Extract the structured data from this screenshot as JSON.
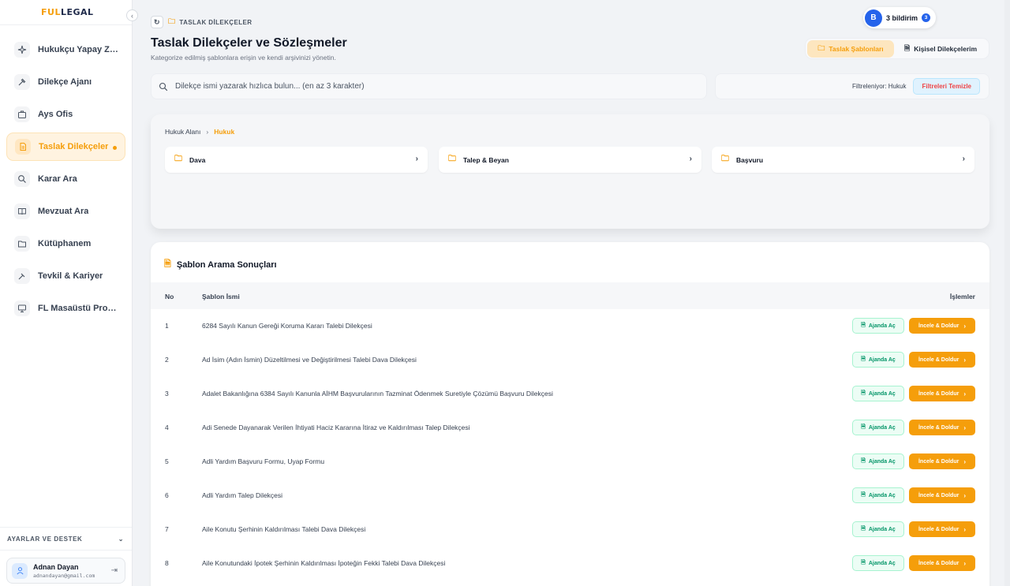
{
  "logo": {
    "part1": "FUL",
    "part2": "LEGAL"
  },
  "sidebar": {
    "items": [
      {
        "label": "Hukukçu Yapay Zeka",
        "icon": "sparkles-icon"
      },
      {
        "label": "Dilekçe Ajanı",
        "icon": "gavel-icon"
      },
      {
        "label": "Ays Ofis",
        "icon": "briefcase-icon"
      },
      {
        "label": "Taslak Dilekçeler",
        "icon": "document-icon",
        "active": true
      },
      {
        "label": "Karar Ara",
        "icon": "search-icon"
      },
      {
        "label": "Mevzuat Ara",
        "icon": "book-icon"
      },
      {
        "label": "Kütüphanem",
        "icon": "folder-icon"
      },
      {
        "label": "Tevkil & Kariyer",
        "icon": "hammer-icon"
      },
      {
        "label": "FL Masaüstü Programı",
        "icon": "desktop-icon"
      }
    ],
    "settings_label": "AYARLAR VE DESTEK",
    "user": {
      "name": "Adnan Dayan",
      "email": "adnandayan@gmail.com"
    }
  },
  "header": {
    "breadcrumb": "TASLAK DİLEKÇELER",
    "title": "Taslak Dilekçeler ve Sözleşmeler",
    "subtitle": "Kategorize edilmiş şablonlara erişin ve kendi arşivinizi yönetin.",
    "notifications": {
      "avatar": "B",
      "label": "3 bildirim",
      "count": "3"
    },
    "tabs": [
      {
        "label": "Taslak Şablonları",
        "active": true
      },
      {
        "label": "Kişisel Dilekçelerim",
        "active": false
      }
    ]
  },
  "search": {
    "placeholder": "Dilekçe ismi yazarak hızlıca bulun... (en az 3 karakter)",
    "value": ""
  },
  "filter": {
    "text": "Filtreleniyor: Hukuk",
    "clear_label": "Filtreleri Temizle"
  },
  "categories": {
    "breadcrumb_root": "Hukuk Alanı",
    "breadcrumb_current": "Hukuk",
    "items": [
      "Dava",
      "Talep & Beyan",
      "Başvuru"
    ]
  },
  "results": {
    "title": "Şablon Arama Sonuçları",
    "columns": {
      "no": "No",
      "name": "Şablon İsmi",
      "actions": "İşlemler"
    },
    "action_a": "Ajanda Aç",
    "action_b": "İncele & Doldur",
    "rows": [
      {
        "no": "1",
        "name": "6284 Sayılı Kanun Gereği Koruma Kararı Talebi Dilekçesi"
      },
      {
        "no": "2",
        "name": "Ad İsim (Adın İsmin) Düzeltilmesi ve Değiştirilmesi Talebi Dava Dilekçesi"
      },
      {
        "no": "3",
        "name": "Adalet Bakanlığına 6384 Sayılı Kanunla AİHM Başvurularının Tazminat Ödenmek Suretiyle Çözümü Başvuru Dilekçesi"
      },
      {
        "no": "4",
        "name": "Adi Senede Dayanarak Verilen İhtiyati Haciz Kararına İtiraz ve Kaldırılması Talep Dilekçesi"
      },
      {
        "no": "5",
        "name": "Adli Yardım Başvuru Formu, Uyap Formu"
      },
      {
        "no": "6",
        "name": "Adli Yardım Talep Dilekçesi"
      },
      {
        "no": "7",
        "name": "Aile Konutu Şerhinin Kaldırılması Talebi Dava Dilekçesi"
      },
      {
        "no": "8",
        "name": "Aile Konutundaki İpotek Şerhinin Kaldırılması İpoteğin Fekki Talebi Dava Dilekçesi"
      }
    ]
  },
  "colors": {
    "accent": "#f59e0b",
    "brand": "#1f2a4a",
    "success": "#059669",
    "primary": "#2563eb"
  }
}
